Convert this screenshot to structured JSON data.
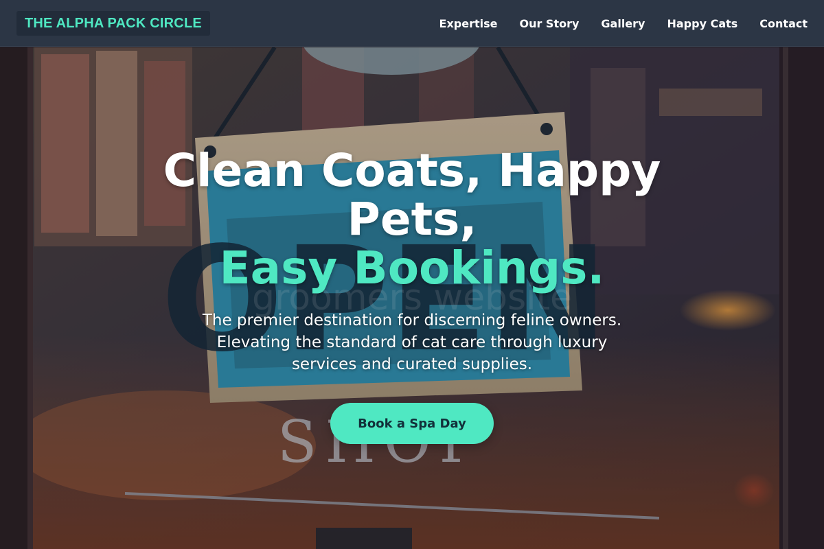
{
  "brand": {
    "name": "THE ALPHA PACK CIRCLE",
    "accent_color": "#4fe8c2",
    "header_color": "#2c3645"
  },
  "nav": {
    "items": [
      {
        "label": "Expertise"
      },
      {
        "label": "Our Story"
      },
      {
        "label": "Gallery"
      },
      {
        "label": "Happy Cats"
      },
      {
        "label": "Contact"
      }
    ]
  },
  "hero": {
    "headline_line1": "Clean Coats, Happy",
    "headline_line2": "Pets,",
    "headline_accent": "Easy Bookings.",
    "tagline": "The premier destination for discerning feline owners. Elevating the standard of cat care through luxury services and curated supplies.",
    "cta_label": "Book a Spa Day",
    "background_sign_text": "OPEN",
    "background_window_text": "groomers website",
    "background_shop_text": "SHOP"
  }
}
